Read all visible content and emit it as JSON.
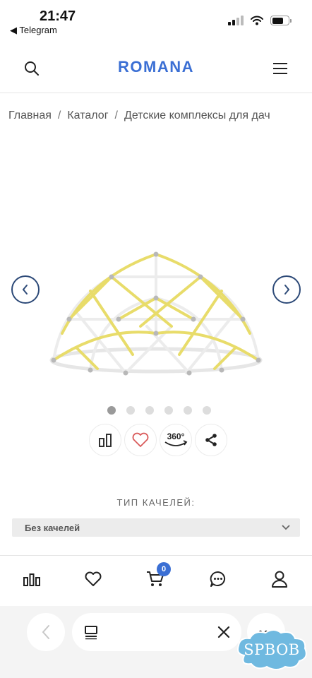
{
  "status_bar": {
    "time": "21:47",
    "back_app": "◀ Telegram"
  },
  "header": {
    "logo": "ROMANA",
    "search_icon": "search-icon",
    "menu_icon": "hamburger-icon"
  },
  "breadcrumb": {
    "items": [
      "Главная",
      "Каталог",
      "Детские комплексы для дач"
    ],
    "separator": "/"
  },
  "gallery": {
    "total_images": 6,
    "active_index": 0,
    "image_alt": "dome climbing frame"
  },
  "actions": {
    "compare_icon": "compare-icon",
    "favorite_icon": "heart-icon",
    "view360_label": "360°",
    "share_icon": "share-icon"
  },
  "swing": {
    "label": "ТИП КАЧЕЛЕЙ:",
    "selected": "Без качелей"
  },
  "tabbar": {
    "cart_count": "0",
    "items": [
      "compare-icon",
      "heart-icon",
      "cart-icon",
      "chat-icon",
      "profile-icon"
    ]
  },
  "watermark": {
    "text": "SPBOB"
  },
  "colors": {
    "brand": "#3b6fd4",
    "arrow_border": "#2d4a78",
    "heart": "#d95a5a",
    "dome_yellow": "#e8dc6a",
    "dome_white": "#f0f0f0",
    "watermark": "#6fb9e0"
  }
}
